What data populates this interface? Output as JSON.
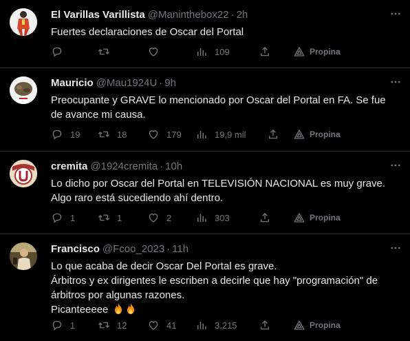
{
  "tweets": [
    {
      "name": "El Varillas Varillista",
      "handle": "@Maninthebox22",
      "time": "2h",
      "lines": [
        "Fuertes declaraciones de Oscar del Portal"
      ],
      "replies": "",
      "retweets": "",
      "likes": "",
      "views": "109",
      "promote": "Propina"
    },
    {
      "name": "Mauricio",
      "handle": "@Mau1924U",
      "time": "9h",
      "lines": [
        "Preocupante y GRAVE lo mencionado por Oscar del Portal en FA. Se fue",
        "de avance mi causa."
      ],
      "replies": "19",
      "retweets": "18",
      "likes": "179",
      "views": "19,9 mil",
      "promote": "Propina"
    },
    {
      "name": "cremita",
      "handle": "@1924cremita",
      "time": "10h",
      "lines": [
        "Lo dicho por Oscar del Portal en TELEVISIÓN NACIONAL es muy grave.",
        "Algo raro está sucediendo ahí dentro."
      ],
      "replies": "1",
      "retweets": "1",
      "likes": "2",
      "views": "303",
      "promote": "Propina"
    },
    {
      "name": "Francisco",
      "handle": "@Fcoo_2023",
      "time": "11h",
      "lines": [
        "Lo que acaba de decir Oscar Del Portal es grave.",
        "Árbitros y ex dirigentes le escriben a decirle que hay \"programación\" de",
        "árbitros por algunas razones.",
        "Picanteeeee"
      ],
      "replies": "1",
      "retweets": "12",
      "likes": "41",
      "views": "3.215",
      "promote": "Propina"
    }
  ],
  "icons": {
    "reply": "reply-icon",
    "retweet": "retweet-icon",
    "like": "heart-icon",
    "views": "views-chart-icon",
    "share": "share-icon",
    "promote": "promote-triangle-icon",
    "more": "more-dots-icon",
    "fire": "fire-emoji-icon"
  },
  "colors": {
    "background": "#000000",
    "text": "#e7e9ea",
    "muted": "#71767b",
    "divider": "#2f3336"
  }
}
